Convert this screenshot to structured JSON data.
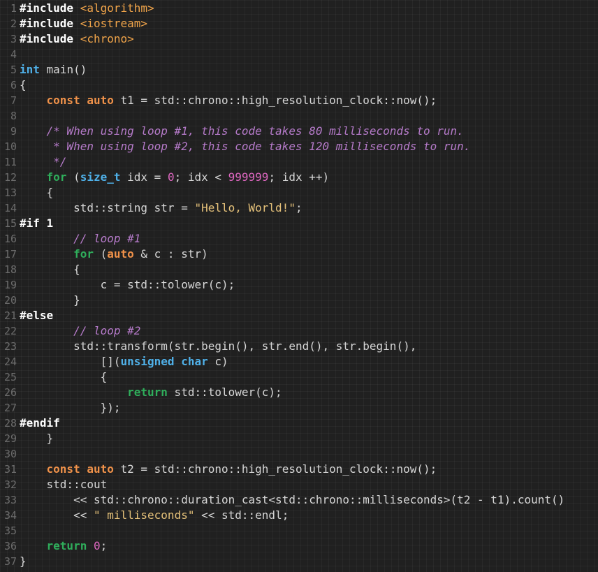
{
  "editor": {
    "lines": [
      {
        "num": "1",
        "tokens": [
          {
            "t": "#include ",
            "c": "preproc"
          },
          {
            "t": "<algorithm>",
            "c": "include"
          }
        ]
      },
      {
        "num": "2",
        "tokens": [
          {
            "t": "#include ",
            "c": "preproc"
          },
          {
            "t": "<iostream>",
            "c": "include"
          }
        ]
      },
      {
        "num": "3",
        "tokens": [
          {
            "t": "#include ",
            "c": "preproc"
          },
          {
            "t": "<chrono>",
            "c": "include"
          }
        ]
      },
      {
        "num": "4",
        "tokens": []
      },
      {
        "num": "5",
        "tokens": [
          {
            "t": "int",
            "c": "type"
          },
          {
            "t": " main()",
            "c": "plain"
          }
        ]
      },
      {
        "num": "6",
        "tokens": [
          {
            "t": "{",
            "c": "plain"
          }
        ]
      },
      {
        "num": "7",
        "tokens": [
          {
            "t": "    ",
            "c": "plain"
          },
          {
            "t": "const",
            "c": "kw"
          },
          {
            "t": " ",
            "c": "plain"
          },
          {
            "t": "auto",
            "c": "kw"
          },
          {
            "t": " t1 = std::chrono::high_resolution_clock::now();",
            "c": "plain"
          }
        ]
      },
      {
        "num": "8",
        "tokens": []
      },
      {
        "num": "9",
        "tokens": [
          {
            "t": "    /* When using loop #1, this code takes 80 milliseconds to run.",
            "c": "comment"
          }
        ]
      },
      {
        "num": "10",
        "tokens": [
          {
            "t": "     * When using loop #2, this code takes 120 milliseconds to run.",
            "c": "comment"
          }
        ]
      },
      {
        "num": "11",
        "tokens": [
          {
            "t": "     */",
            "c": "comment"
          }
        ]
      },
      {
        "num": "12",
        "tokens": [
          {
            "t": "    ",
            "c": "plain"
          },
          {
            "t": "for",
            "c": "flow"
          },
          {
            "t": " (",
            "c": "plain"
          },
          {
            "t": "size_t",
            "c": "type"
          },
          {
            "t": " idx = ",
            "c": "plain"
          },
          {
            "t": "0",
            "c": "number"
          },
          {
            "t": "; idx < ",
            "c": "plain"
          },
          {
            "t": "999999",
            "c": "number"
          },
          {
            "t": "; idx ++)",
            "c": "plain"
          }
        ]
      },
      {
        "num": "13",
        "tokens": [
          {
            "t": "    {",
            "c": "plain"
          }
        ]
      },
      {
        "num": "14",
        "tokens": [
          {
            "t": "        std::string str = ",
            "c": "plain"
          },
          {
            "t": "\"Hello, World!\"",
            "c": "string"
          },
          {
            "t": ";",
            "c": "plain"
          }
        ]
      },
      {
        "num": "15",
        "tokens": [
          {
            "t": "#if 1",
            "c": "preproc"
          }
        ]
      },
      {
        "num": "16",
        "tokens": [
          {
            "t": "        // loop #1",
            "c": "comment"
          }
        ]
      },
      {
        "num": "17",
        "tokens": [
          {
            "t": "        ",
            "c": "plain"
          },
          {
            "t": "for",
            "c": "flow"
          },
          {
            "t": " (",
            "c": "plain"
          },
          {
            "t": "auto",
            "c": "kw"
          },
          {
            "t": " & c : str)",
            "c": "plain"
          }
        ]
      },
      {
        "num": "18",
        "tokens": [
          {
            "t": "        {",
            "c": "plain"
          }
        ]
      },
      {
        "num": "19",
        "tokens": [
          {
            "t": "            c = std::tolower(c);",
            "c": "plain"
          }
        ]
      },
      {
        "num": "20",
        "tokens": [
          {
            "t": "        }",
            "c": "plain"
          }
        ]
      },
      {
        "num": "21",
        "tokens": [
          {
            "t": "#else",
            "c": "preproc"
          }
        ]
      },
      {
        "num": "22",
        "tokens": [
          {
            "t": "        // loop #2",
            "c": "comment"
          }
        ]
      },
      {
        "num": "23",
        "tokens": [
          {
            "t": "        std::transform(str.begin(), str.end(), str.begin(),",
            "c": "plain"
          }
        ]
      },
      {
        "num": "24",
        "tokens": [
          {
            "t": "            [](",
            "c": "plain"
          },
          {
            "t": "unsigned",
            "c": "type"
          },
          {
            "t": " ",
            "c": "plain"
          },
          {
            "t": "char",
            "c": "type"
          },
          {
            "t": " c)",
            "c": "plain"
          }
        ]
      },
      {
        "num": "25",
        "tokens": [
          {
            "t": "            {",
            "c": "plain"
          }
        ]
      },
      {
        "num": "26",
        "tokens": [
          {
            "t": "                ",
            "c": "plain"
          },
          {
            "t": "return",
            "c": "flow"
          },
          {
            "t": " std::tolower(c);",
            "c": "plain"
          }
        ]
      },
      {
        "num": "27",
        "tokens": [
          {
            "t": "            });",
            "c": "plain"
          }
        ]
      },
      {
        "num": "28",
        "tokens": [
          {
            "t": "#endif",
            "c": "preproc"
          }
        ]
      },
      {
        "num": "29",
        "tokens": [
          {
            "t": "    }",
            "c": "plain"
          }
        ]
      },
      {
        "num": "30",
        "tokens": []
      },
      {
        "num": "31",
        "tokens": [
          {
            "t": "    ",
            "c": "plain"
          },
          {
            "t": "const",
            "c": "kw"
          },
          {
            "t": " ",
            "c": "plain"
          },
          {
            "t": "auto",
            "c": "kw"
          },
          {
            "t": " t2 = std::chrono::high_resolution_clock::now();",
            "c": "plain"
          }
        ]
      },
      {
        "num": "32",
        "tokens": [
          {
            "t": "    std::cout",
            "c": "plain"
          }
        ]
      },
      {
        "num": "33",
        "tokens": [
          {
            "t": "        << std::chrono::duration_cast<std::chrono::milliseconds>(t2 - t1).count()",
            "c": "plain"
          }
        ]
      },
      {
        "num": "34",
        "tokens": [
          {
            "t": "        << ",
            "c": "plain"
          },
          {
            "t": "\" milliseconds\"",
            "c": "string"
          },
          {
            "t": " << std::endl;",
            "c": "plain"
          }
        ]
      },
      {
        "num": "35",
        "tokens": []
      },
      {
        "num": "36",
        "tokens": [
          {
            "t": "    ",
            "c": "plain"
          },
          {
            "t": "return",
            "c": "flow"
          },
          {
            "t": " ",
            "c": "plain"
          },
          {
            "t": "0",
            "c": "number"
          },
          {
            "t": ";",
            "c": "plain"
          }
        ]
      },
      {
        "num": "37",
        "tokens": [
          {
            "t": "}",
            "c": "plain"
          }
        ]
      }
    ]
  }
}
